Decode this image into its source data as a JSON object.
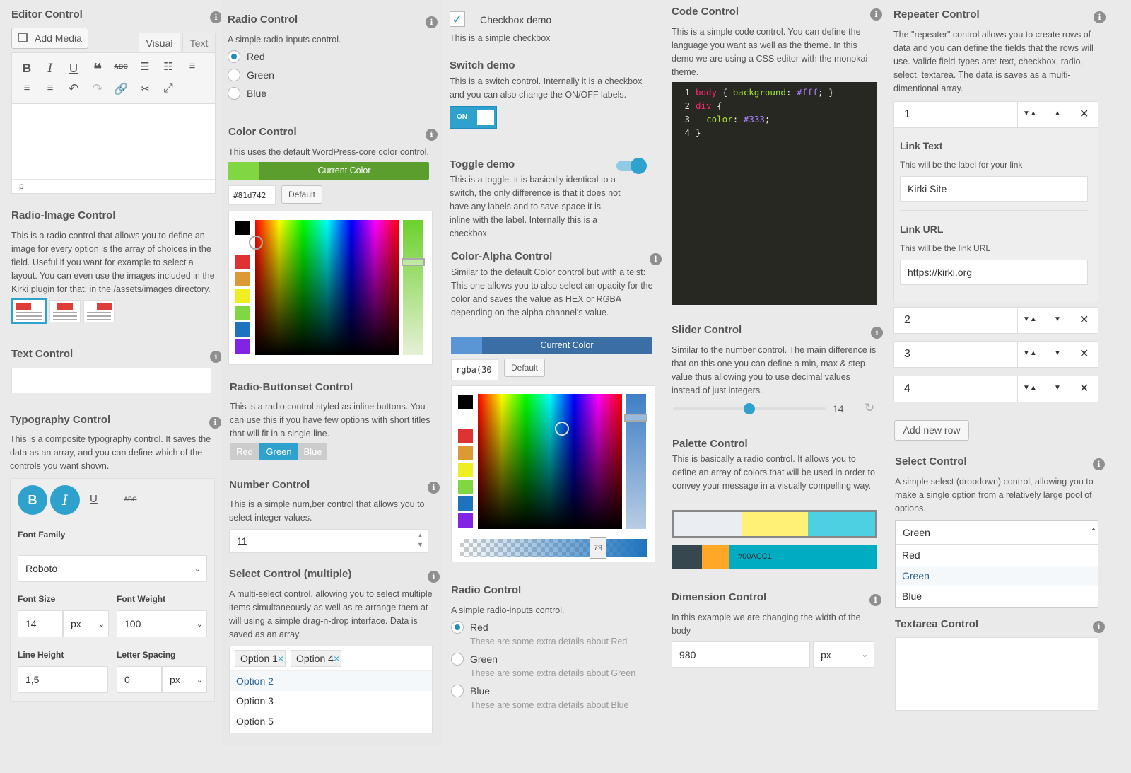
{
  "editor": {
    "title": "Editor Control",
    "add_media": "Add Media",
    "tab_visual": "Visual",
    "tab_text": "Text",
    "path": "p"
  },
  "radio_image": {
    "title": "Radio-Image Control",
    "desc": "This is a radio control that allows you to define an image for every option is the array of choices in the field. Useful if you want for example to select a layout. You can even use the images included in the Kirki plugin for that, in the /assets/images directory."
  },
  "text_control": {
    "title": "Text Control",
    "value": ""
  },
  "typography": {
    "title": "Typography Control",
    "desc": "This is a composite typography control. It saves the data as an array, and you can define which of the controls you want shown.",
    "font_family_label": "Font Family",
    "font_family": "Roboto",
    "font_size_label": "Font Size",
    "font_size": "14",
    "font_size_unit": "px",
    "font_weight_label": "Font Weight",
    "font_weight": "100",
    "line_height_label": "Line Height",
    "line_height": "1,5",
    "letter_spacing_label": "Letter Spacing",
    "letter_spacing": "0",
    "letter_spacing_unit": "px"
  },
  "radio1": {
    "title": "Radio Control",
    "desc": "A simple radio-inputs control.",
    "options": [
      "Red",
      "Green",
      "Blue"
    ],
    "selected": "Red"
  },
  "color": {
    "title": "Color Control",
    "desc": "This uses the default WordPress-core color control.",
    "button": "Current Color",
    "hex": "#81d742",
    "default": "Default",
    "swatch": "#81d742",
    "bar": "#5c9e2e"
  },
  "buttonset": {
    "title": "Radio-Buttonset Control",
    "desc": "This is a radio control styled as inline buttons. You can use this if you have few options with short titles that will fit in a single line.",
    "options": [
      "Red",
      "Green",
      "Blue"
    ],
    "selected": "Green"
  },
  "number": {
    "title": "Number Control",
    "desc": "This is a simple num,ber control that allows you to select integer values.",
    "value": "11"
  },
  "select_multi": {
    "title": "Select Control (multiple)",
    "desc": "A multi-select control, allowing you to select multiple items simultaneously as well as re-arrange them at will using a simple drag-n-drop interface. Data is saved as an array.",
    "selected": [
      "Option 1",
      "Option 4"
    ],
    "options": [
      "Option 2",
      "Option 3",
      "Option 5"
    ]
  },
  "checkbox": {
    "label": "Checkbox demo",
    "desc": "This is a simple checkbox"
  },
  "switch": {
    "title": "Switch demo",
    "desc": "This is a switch control. Internally it is a checkbox and you can also change the ON/OFF labels.",
    "on_label": "ON"
  },
  "toggle": {
    "title": "Toggle demo",
    "desc": "This is a toggle. it is basically identical to a switch, the only difference is that it does not have any labels and to save space it is inline with the label. Internally this is a checkbox."
  },
  "color_alpha": {
    "title": "Color-Alpha Control",
    "desc": "Similar to the default Color control but with a teist: This one allows you to also select an opacity for the color and saves the value as HEX or RGBA depending on the alpha channel's value.",
    "button": "Current Color",
    "value": "rgba(30",
    "default": "Default",
    "alpha": "79"
  },
  "radio2": {
    "title": "Radio Control",
    "desc": "A simple radio-inputs control.",
    "options": [
      {
        "label": "Red",
        "detail": "These are some extra details about Red"
      },
      {
        "label": "Green",
        "detail": "These are some extra details about Green"
      },
      {
        "label": "Blue",
        "detail": "These are some extra details about Blue"
      }
    ],
    "selected": "Red"
  },
  "code": {
    "title": "Code Control",
    "desc": "This is a simple code control. You can define the language you want as well as the theme. In this demo we are using a CSS editor with the monokai theme.",
    "line_numbers": [
      "1",
      "2",
      "3",
      "4"
    ]
  },
  "slider": {
    "title": "Slider Control",
    "desc": "Similar to the number control. The main difference is that on this one you can define a min, max & step value thus allowing you to use decimal values instead of just integers.",
    "value": "14",
    "position_fraction": 0.5
  },
  "palette": {
    "title": "Palette Control",
    "desc": "This is basically a radio control. It allows you to define an array of colors that will be used in order to convey your message in a visually compelling way.",
    "palette1": [
      "#eaeef2",
      "#fff176",
      "#4dd0e1"
    ],
    "palette2": [
      "#37474f",
      "#ffa726",
      "#00acc1"
    ],
    "label": "#00ACC1"
  },
  "dimension": {
    "title": "Dimension Control",
    "desc": "In this example we are changing the width of the body",
    "value": "980",
    "unit": "px"
  },
  "repeater": {
    "title": "Repeater Control",
    "desc": "The \"repeater\" control allows you to create rows of data and you can define the fields that the rows will use. Valide field-types are: text, checkbox, radio, select, textarea. The data is saves as a multi-dimentional array.",
    "rows": [
      "1",
      "2",
      "3",
      "4"
    ],
    "link_text_label": "Link Text",
    "link_text_desc": "This will be the label for your link",
    "link_text": "Kirki Site",
    "link_url_label": "Link URL",
    "link_url_desc": "This will be the link URL",
    "link_url": "https://kirki.org",
    "add_row": "Add new row"
  },
  "select": {
    "title": "Select Control",
    "desc": "A simple select (dropdown) control, allowing you to make a single option from a relatively large pool of options.",
    "value": "Green",
    "options": [
      "Red",
      "Green",
      "Blue"
    ]
  },
  "textarea": {
    "title": "Textarea Control",
    "value": ""
  }
}
